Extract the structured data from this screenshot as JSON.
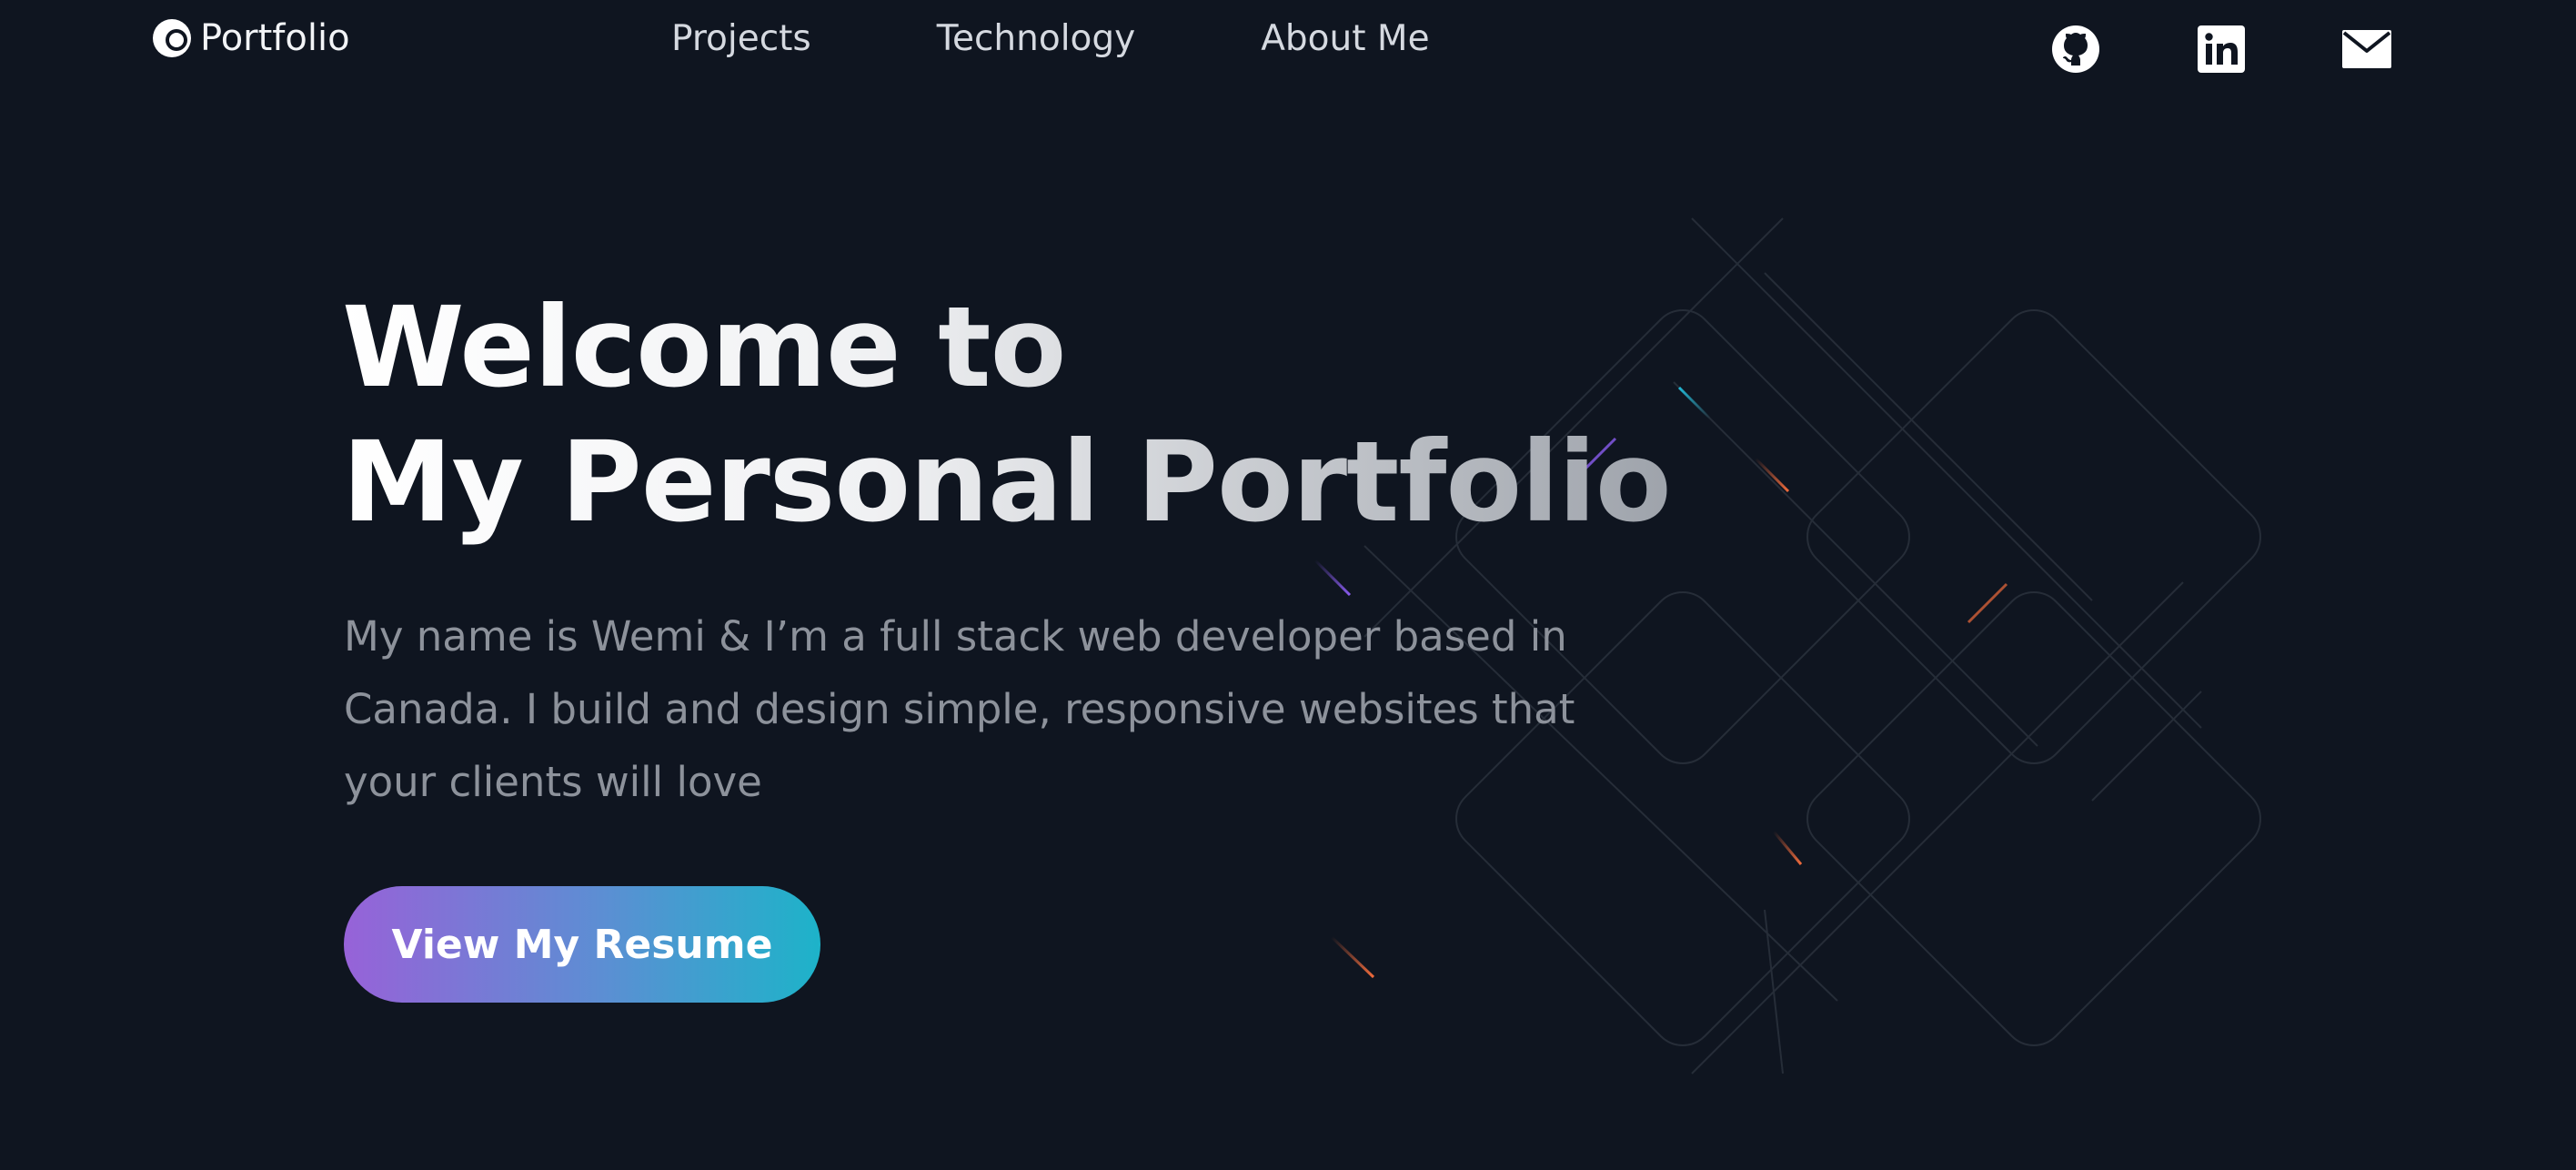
{
  "brand": {
    "name": "Portfolio",
    "logo_icon": "crescent-circle-logo"
  },
  "nav": {
    "items": [
      {
        "label": "Projects"
      },
      {
        "label": "Technology"
      },
      {
        "label": "About Me"
      }
    ]
  },
  "socials": [
    {
      "icon": "github-icon"
    },
    {
      "icon": "linkedin-icon"
    },
    {
      "icon": "mail-icon"
    }
  ],
  "hero": {
    "title_line1": "Welcome to",
    "title_line2": "My Personal Portfolio",
    "description": "My name is Wemi & I’m a full stack web developer based in Canada. I build and design simple, responsive websites that your clients will love",
    "cta_label": "View My Resume"
  },
  "colors": {
    "background": "#0f1520",
    "nav_text": "#d5d9e0",
    "description_text": "#8d929b",
    "cta_gradient_start": "#9762d8",
    "cta_gradient_end": "#1db3c9",
    "accent_orange": "#f06b3c",
    "accent_cyan": "#22b8d6",
    "accent_purple": "#8a5cf0"
  }
}
